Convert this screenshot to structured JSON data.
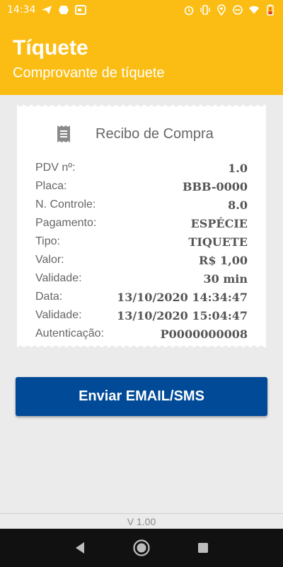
{
  "status_bar": {
    "time": "14:34",
    "left_icons": [
      "send-icon",
      "hexagon-icon",
      "card-icon"
    ],
    "right_icons": [
      "alarm-icon",
      "vibrate-icon",
      "location-icon",
      "dnd-icon",
      "wifi-icon",
      "battery-icon"
    ]
  },
  "header": {
    "title": "Tíquete",
    "subtitle": "Comprovante de tíquete"
  },
  "receipt": {
    "title": "Recibo de Compra",
    "rows": [
      {
        "label": "PDV nº:",
        "value": "1.0"
      },
      {
        "label": "Placa:",
        "value": "BBB-0000"
      },
      {
        "label": "N. Controle:",
        "value": "8.0"
      },
      {
        "label": "Pagamento:",
        "value": "ESPÉCIE"
      },
      {
        "label": "Tipo:",
        "value": "TIQUETE"
      },
      {
        "label": "Valor:",
        "value": "R$ 1,00"
      },
      {
        "label": "Validade:",
        "value": "30 min"
      },
      {
        "label": "Data:",
        "value": "13/10/2020 14:34:47"
      },
      {
        "label": "Validade:",
        "value": "13/10/2020 15:04:47"
      },
      {
        "label": "Autenticação:",
        "value": "P0000000008"
      }
    ]
  },
  "actions": {
    "send_label": "Enviar EMAIL/SMS"
  },
  "footer": {
    "version": "V 1.00"
  },
  "colors": {
    "header_bg": "#fbbd13",
    "button_bg": "#004a98",
    "background": "#ebebeb"
  }
}
